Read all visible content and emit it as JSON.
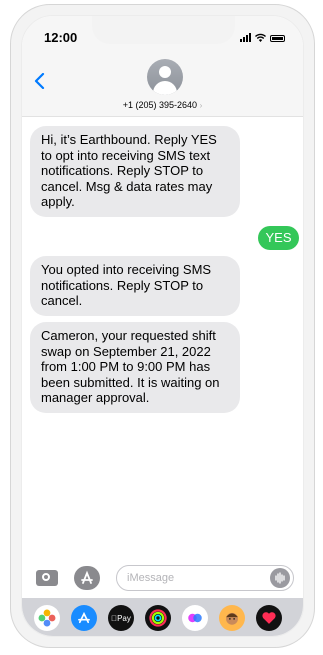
{
  "status_bar": {
    "time": "12:00"
  },
  "contact": {
    "phone": "+1 (205) 395-2640",
    "chevron": "›"
  },
  "messages": [
    {
      "from": "them",
      "text": "Hi, it’s Earthbound. Reply YES to opt into receiving SMS text notifications. Reply STOP to cancel. Msg & data rates may apply."
    },
    {
      "from": "me",
      "text": "YES"
    },
    {
      "from": "them",
      "text": "You opted into receiving SMS notifications. Reply STOP to cancel."
    },
    {
      "from": "them",
      "text": "Cameron, your requested shift swap on September 21, 2022 from 1:00 PM to 9:00 PM has been submitted. It is waiting on manager approval."
    }
  ],
  "composer": {
    "placeholder": "iMessage"
  },
  "app_bar": {
    "apple_pay_label": "Pay",
    "icons": [
      "photos-icon",
      "app-store-icon",
      "apple-pay-icon",
      "activity-icon",
      "memoji-stickers-icon",
      "memoji-icon",
      "digital-touch-icon"
    ]
  },
  "colors": {
    "accent": "#007aff",
    "sent_bubble": "#34c759",
    "received_bubble": "#e9e9eb"
  }
}
